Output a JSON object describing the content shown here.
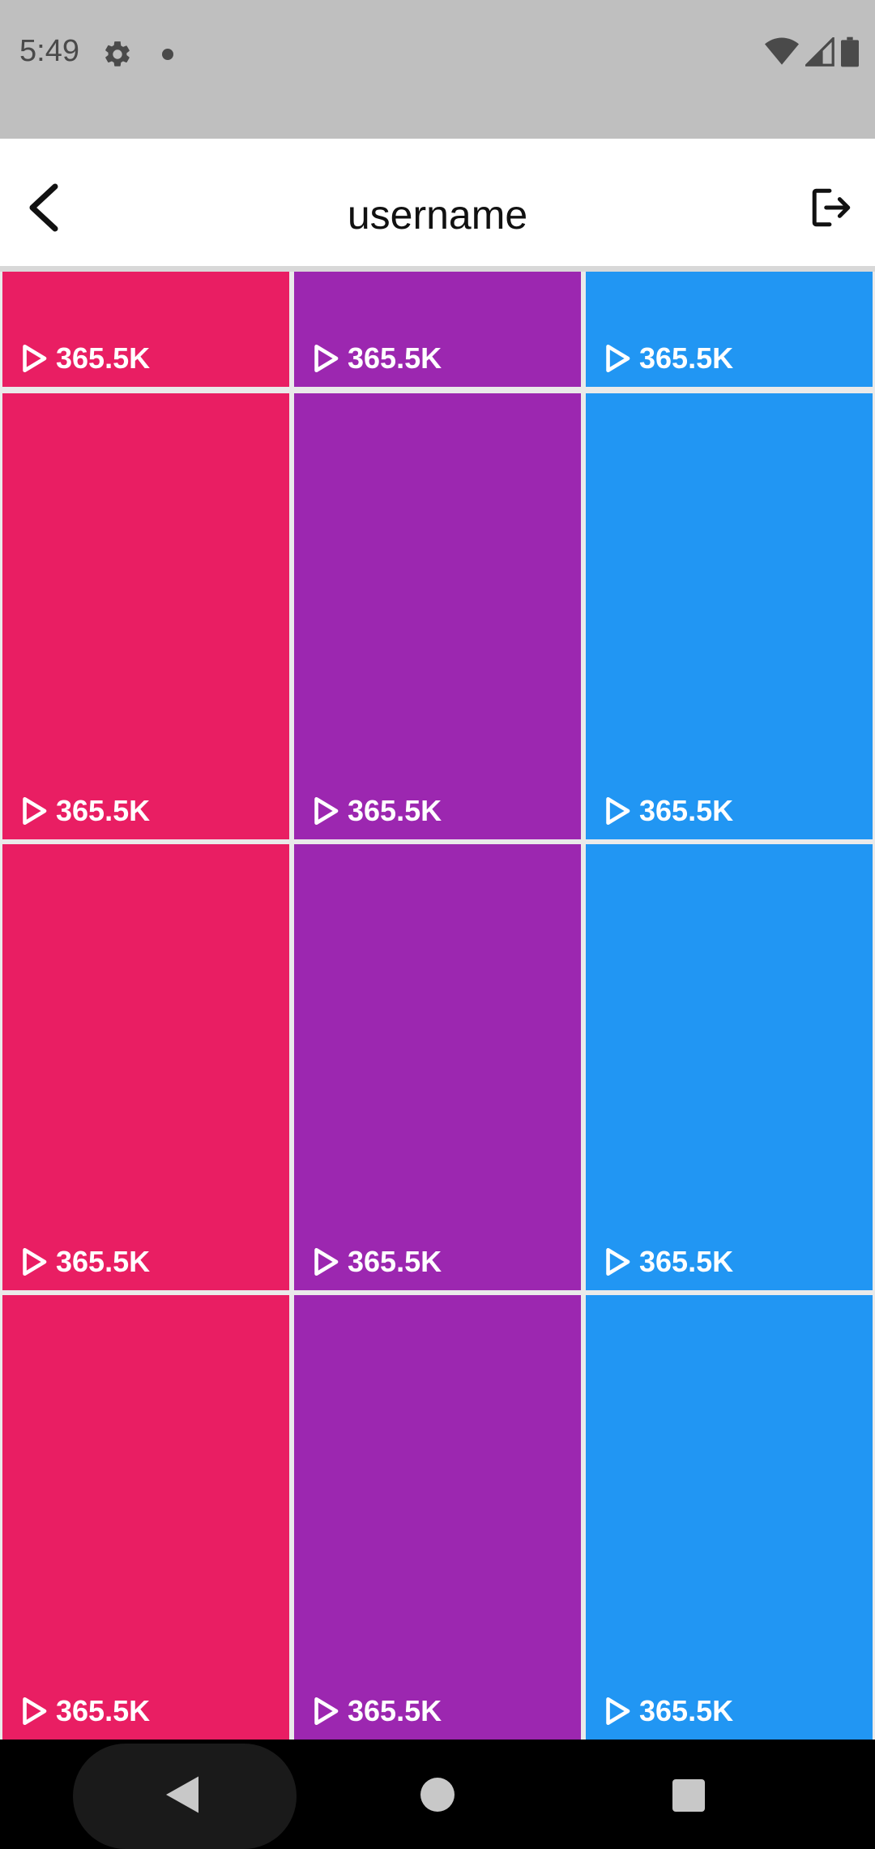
{
  "status_bar": {
    "time": "5:49",
    "icons": [
      "gear-icon",
      "notification-dot-icon",
      "wifi-icon",
      "signal-icon",
      "battery-icon"
    ]
  },
  "app_bar": {
    "title": "username",
    "back_icon": "chevron-left-icon",
    "logout_icon": "logout-icon"
  },
  "colors": {
    "col1": "#E91E63",
    "col2": "#9C27B0",
    "col3": "#2196F3"
  },
  "grid": {
    "tiles": [
      {
        "views": "365.5K"
      },
      {
        "views": "365.5K"
      },
      {
        "views": "365.5K"
      },
      {
        "views": "365.5K"
      },
      {
        "views": "365.5K"
      },
      {
        "views": "365.5K"
      },
      {
        "views": "365.5K"
      },
      {
        "views": "365.5K"
      },
      {
        "views": "365.5K"
      },
      {
        "views": "365.5K"
      },
      {
        "views": "365.5K"
      },
      {
        "views": "365.5K"
      }
    ]
  },
  "nav_bar": {
    "icons": [
      "back-triangle-icon",
      "home-circle-icon",
      "recents-square-icon"
    ]
  }
}
